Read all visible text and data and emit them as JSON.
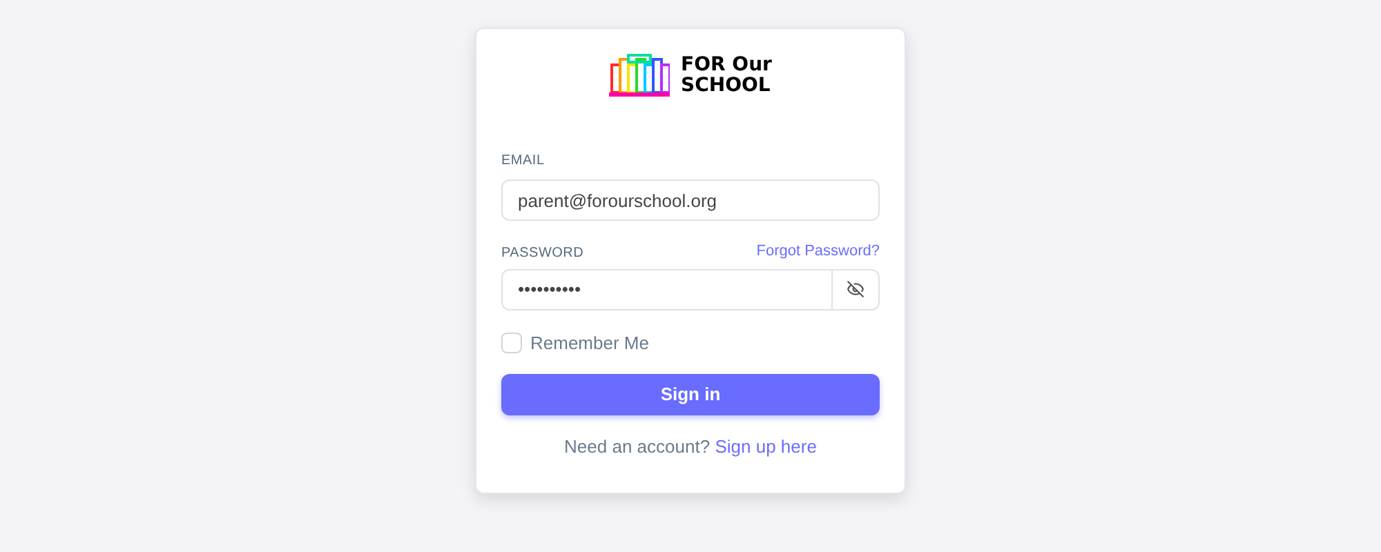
{
  "logo": {
    "lines": [
      "FOR Our",
      "SCHOOL"
    ]
  },
  "email": {
    "label": "EMAIL",
    "value": "parent@forourschool.org"
  },
  "password": {
    "label": "PASSWORD",
    "forgot_link": "Forgot Password?",
    "value": "••••••••••",
    "visible": false
  },
  "remember": {
    "label": "Remember Me",
    "checked": false
  },
  "submit": "Sign in",
  "signup": {
    "text": "Need an account?",
    "link": "Sign up here"
  }
}
